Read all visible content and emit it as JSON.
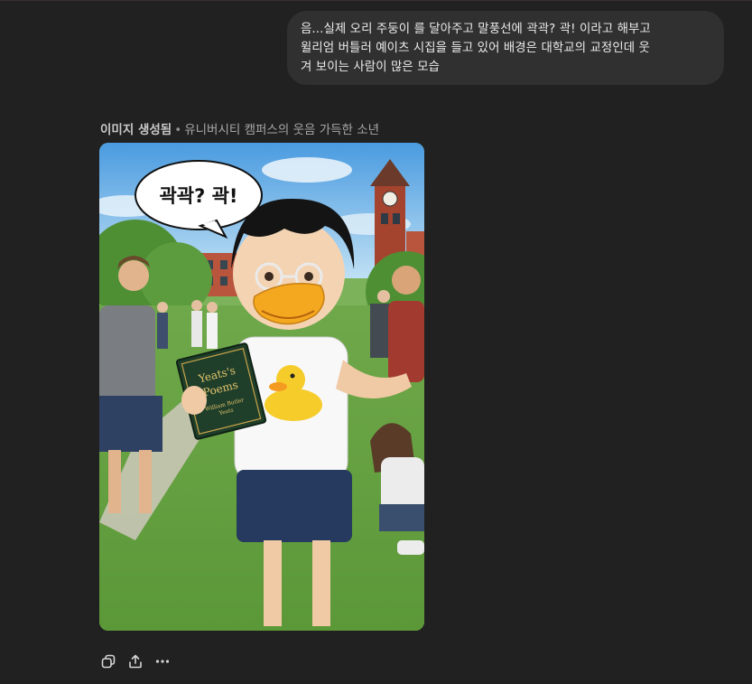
{
  "conversation": {
    "user_message": {
      "lines": [
        "음...실제 오리 주둥이 를 달아주고 말풍선에 곽곽? 곽! 이라고 해부고",
        "윌리엄 버틀러 예이츠 시집을 들고 있어  배경은 대학교의 교정인데 웃",
        "겨 보이는 사람이 많은 모습"
      ]
    },
    "image_result": {
      "status_label": "이미지 생성됨",
      "separator": "•",
      "title": "유니버시티 캠퍼스의 웃음 가득한 소년",
      "speech_bubble_text": "곽곽? 곽!",
      "book_title_line1": "Yeats's",
      "book_title_line2": "Poems",
      "book_author_line1": "William Butler",
      "book_author_line2": "Yeats"
    },
    "actions": [
      {
        "name": "copy",
        "icon": "copy-icon"
      },
      {
        "name": "share",
        "icon": "share-icon"
      },
      {
        "name": "more",
        "icon": "more-icon"
      }
    ]
  }
}
